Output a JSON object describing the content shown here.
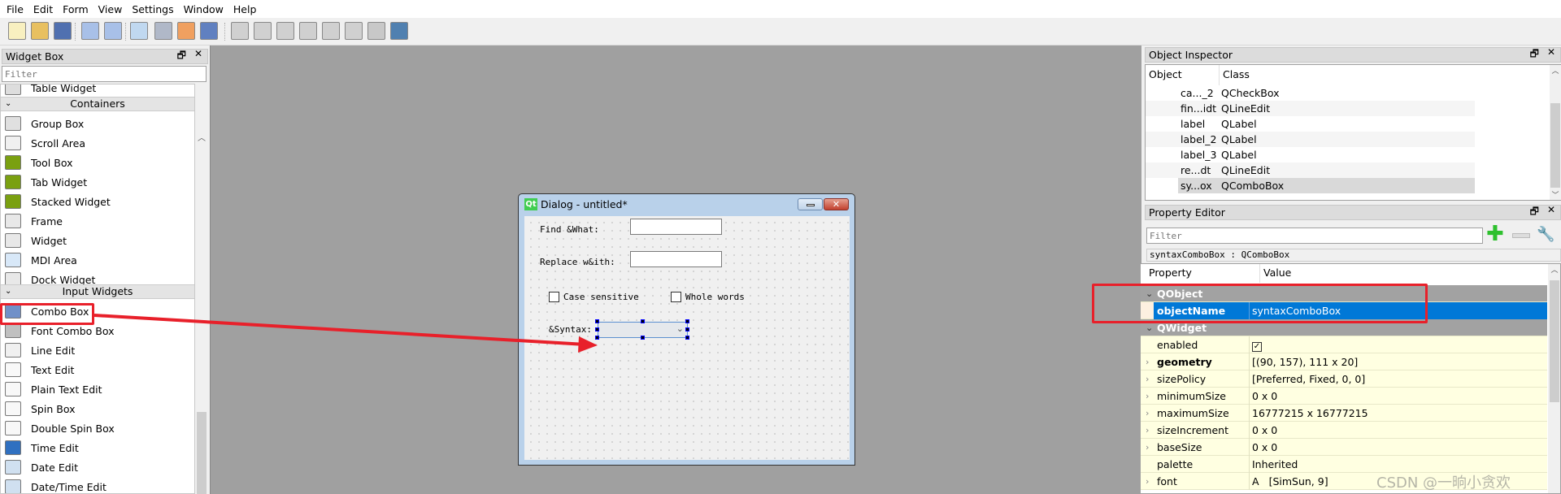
{
  "menu": [
    "File",
    "Edit",
    "Form",
    "View",
    "Settings",
    "Window",
    "Help"
  ],
  "toolbar": {
    "icons": [
      "new-icon",
      "open-icon",
      "save-icon",
      "send-to-back-icon",
      "bring-to-front-icon",
      "edit-widgets-icon",
      "edit-signals-slots-icon",
      "edit-buddies-icon",
      "edit-tab-order-icon",
      "layout-horizontal-icon",
      "layout-vertical-icon",
      "layout-horizontal-splitter-icon",
      "layout-vertical-splitter-icon",
      "layout-grid-icon",
      "layout-form-icon",
      "break-layout-icon",
      "adjust-size-icon"
    ]
  },
  "widget_box": {
    "title": "Widget Box",
    "filter_placeholder": "Filter",
    "partial_item": "Table Widget",
    "categories": [
      {
        "label": "Containers",
        "items": [
          "Group Box",
          "Scroll Area",
          "Tool Box",
          "Tab Widget",
          "Stacked Widget",
          "Frame",
          "Widget",
          "MDI Area",
          "Dock Widget"
        ]
      },
      {
        "label": "Input Widgets",
        "items": [
          "Combo Box",
          "Font Combo Box",
          "Line Edit",
          "Text Edit",
          "Plain Text Edit",
          "Spin Box",
          "Double Spin Box",
          "Time Edit",
          "Date Edit",
          "Date/Time Edit"
        ]
      }
    ]
  },
  "dialog": {
    "title": "Dialog - untitled*",
    "find_label": "Find &What:",
    "replace_label": "Replace w&ith:",
    "case_label": "Case sensitive",
    "whole_label": "Whole words",
    "syntax_label": "&Syntax:"
  },
  "object_inspector": {
    "title": "Object Inspector",
    "columns": [
      "Object",
      "Class"
    ],
    "rows": [
      {
        "object": "ca..._2",
        "class": "QCheckBox"
      },
      {
        "object": "fin...idt",
        "class": "QLineEdit"
      },
      {
        "object": "label",
        "class": "QLabel"
      },
      {
        "object": "label_2",
        "class": "QLabel"
      },
      {
        "object": "label_3",
        "class": "QLabel"
      },
      {
        "object": "re...dt",
        "class": "QLineEdit"
      },
      {
        "object": "sy...ox",
        "class": "QComboBox"
      }
    ],
    "selected": "sy...ox"
  },
  "property_editor": {
    "title": "Property Editor",
    "filter_placeholder": "Filter",
    "context": "syntaxComboBox : QComboBox",
    "columns": [
      "Property",
      "Value"
    ],
    "rows": [
      {
        "group": true,
        "name": "QObject"
      },
      {
        "name": "objectName",
        "value": "syntaxComboBox",
        "bold": true,
        "selected": true
      },
      {
        "group": true,
        "name": "QWidget"
      },
      {
        "name": "enabled",
        "value": "",
        "checkbox": true
      },
      {
        "name": "geometry",
        "value": "[(90, 157), 111 x 20]",
        "bold": true,
        "expandable": true
      },
      {
        "name": "sizePolicy",
        "value": "[Preferred, Fixed, 0, 0]",
        "expandable": true
      },
      {
        "name": "minimumSize",
        "value": "0 x 0",
        "expandable": true
      },
      {
        "name": "maximumSize",
        "value": "16777215 x 16777215",
        "expandable": true
      },
      {
        "name": "sizeIncrement",
        "value": "0 x 0",
        "expandable": true
      },
      {
        "name": "baseSize",
        "value": "0 x 0",
        "expandable": true
      },
      {
        "name": "palette",
        "value": "Inherited"
      },
      {
        "name": "font",
        "value": "[SimSun, 9]",
        "expandable": true,
        "font_glyph": "A"
      }
    ]
  },
  "watermark": "CSDN @一晌小贪欢",
  "colors": {
    "selection": "#0078d7",
    "annotation": "#e8202a",
    "canvas": "#a0a0a0"
  }
}
